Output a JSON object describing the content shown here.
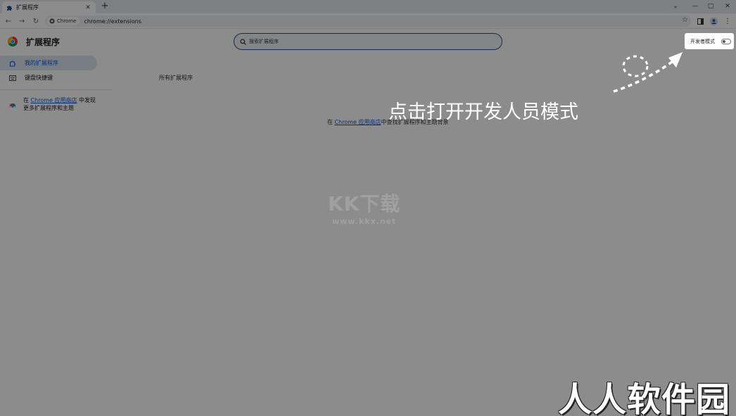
{
  "browser": {
    "tab": {
      "title": "扩展程序"
    },
    "omnibox": {
      "chip_label": "Chrome",
      "url": "chrome://extensions"
    }
  },
  "page": {
    "title": "扩展程序",
    "search_placeholder": "搜索扩展程序",
    "dev_mode_label": "开发者模式",
    "dev_mode_enabled": false
  },
  "sidebar": {
    "items": [
      {
        "label": "我的扩展程序",
        "icon": "extension-icon",
        "active": true
      },
      {
        "label": "键盘快捷键",
        "icon": "keyboard-icon",
        "active": false
      }
    ],
    "store_promo": {
      "prefix": "在 ",
      "link": "Chrome 应用商店",
      "suffix": " 中发现更多扩展程序和主题"
    }
  },
  "main": {
    "section_label": "所有扩展程序",
    "empty": {
      "prefix": "在 ",
      "link": "Chrome 应用商店",
      "suffix": "中查找扩展程序和主题背景"
    }
  },
  "annotation": {
    "callout": "点击打开开发人员模式"
  },
  "watermark": {
    "main": "KK下载",
    "sub": "www.kkx.net"
  },
  "brand": "人人软件园",
  "colors": {
    "accent": "#0b57d0",
    "active_bg": "#dde5f3",
    "overlay": "rgba(0,0,0,0.45)"
  }
}
